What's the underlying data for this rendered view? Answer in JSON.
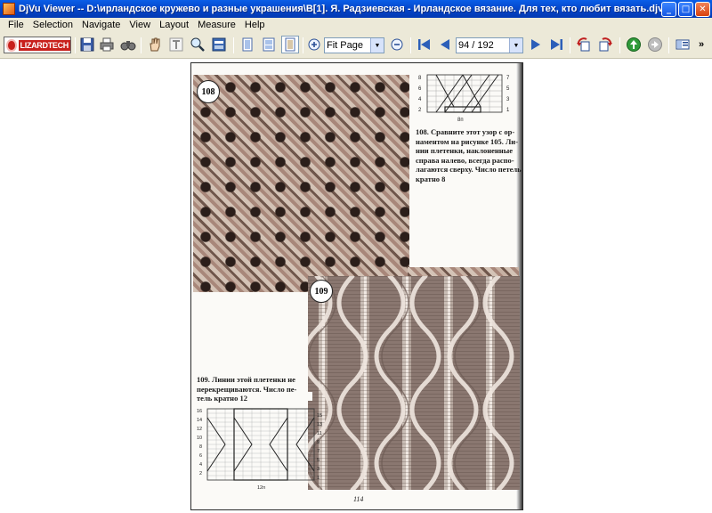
{
  "window": {
    "title": "DjVu Viewer -- D:\\ирландское кружево и разные украшения\\В[1]. Я. Радзиевская - Ирландское вязание. Для тех, кто любит вязать.djvu",
    "minimize": "_",
    "maximize": "□",
    "close": "✕"
  },
  "menu": {
    "items": [
      "File",
      "Selection",
      "Navigate",
      "View",
      "Layout",
      "Measure",
      "Help"
    ]
  },
  "toolbar": {
    "logo": "LIZARDTECH",
    "zoom_value": "Fit Page",
    "page_value": "94 / 192",
    "overflow": "»"
  },
  "document": {
    "page_number": "114",
    "pattern1": {
      "number": "108",
      "caption": [
        "108. Сравните этот узор с ор-",
        "наментом на рисунке 105. Ли-",
        "нии плетенки, наклоненные",
        "справа налево, всегда распо-",
        "лагаются сверху. Число петель",
        "кратно 8"
      ],
      "chart_rows": [
        "8",
        "6",
        "4",
        "2",
        "7",
        "5",
        "3",
        "1"
      ],
      "repeat": "8п"
    },
    "pattern2": {
      "number": "109",
      "caption": [
        "109. Линии этой плетенки не",
        "перекрещиваются. Число пе-",
        "тель кратно 12"
      ],
      "chart_rows_left": [
        "16",
        "14",
        "12",
        "10",
        "8",
        "6",
        "4",
        "2"
      ],
      "chart_rows_right": [
        "15",
        "13",
        "11",
        "9",
        "7",
        "5",
        "3",
        "1"
      ],
      "repeat": "12п"
    }
  },
  "colors": {
    "titlebar": "#0446c9",
    "chrome": "#ece9d8",
    "brand": "#c8201c"
  }
}
